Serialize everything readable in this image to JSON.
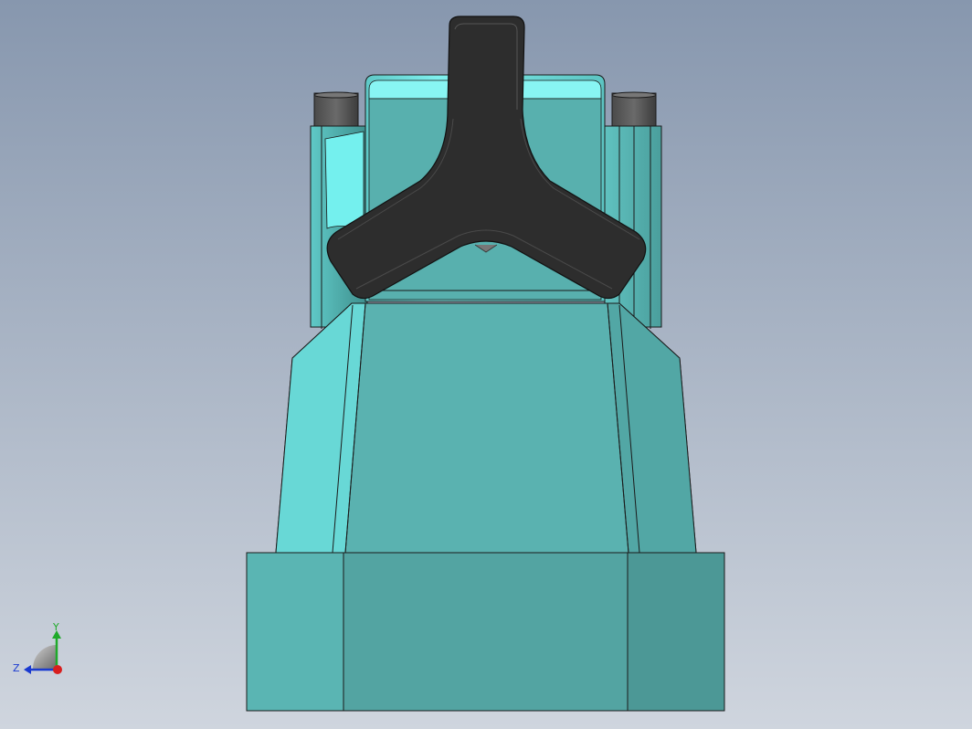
{
  "viewport": {
    "background_top": "#8797ae",
    "background_bottom": "#cfd5de"
  },
  "model": {
    "body_color": "#5bb2b0",
    "body_light": "#6fd6d4",
    "body_dark": "#4f9b99",
    "cap_color": "#66e6e6",
    "knob_color": "#2c2c2c",
    "pin_color": "#555555",
    "edge_color": "#1a1a1a"
  },
  "triad": {
    "x_color": "#d81e1e",
    "y_color": "#1faa2a",
    "z_color": "#1a3ad0",
    "y_label": "Y",
    "z_label": "Z"
  }
}
